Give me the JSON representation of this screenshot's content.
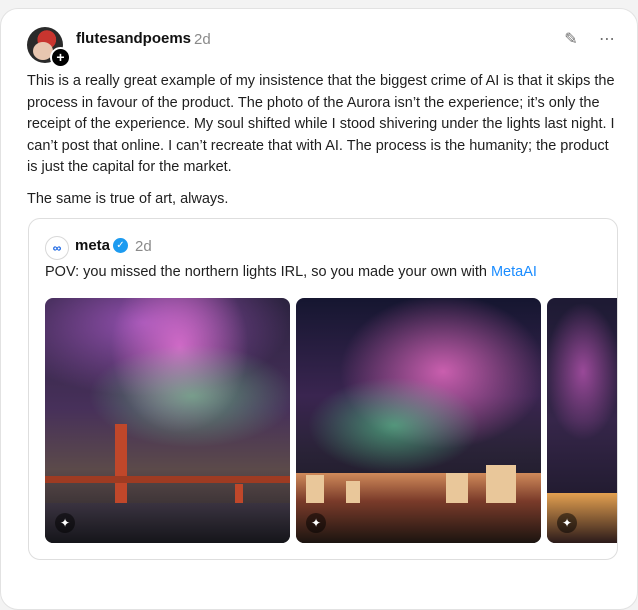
{
  "post": {
    "username": "flutesandpoems",
    "time": "2d",
    "paragraphs": [
      "This is a really great example of my insistence that the biggest crime of AI is that it skips the process in favour of the product. The photo of the Aurora isn’t the experience; it’s only the receipt of the experience. My soul shifted while I stood shivering under the lights last night. I can’t post that online. I can’t recreate that with AI. The process is the humanity; the product is just the capital for the market.",
      "The same is true of art, always."
    ]
  },
  "quote": {
    "name": "meta",
    "time": "2d",
    "text": "POV: you missed the northern lights IRL, so you made your own with ",
    "link": "MetaAI"
  },
  "icons": {
    "follow": "+",
    "edit": "✎",
    "more": "⋯",
    "logo": "∞",
    "verified": "✓",
    "ai": "✦"
  },
  "colors": {
    "link": "#1a8cff",
    "verified": "#1d9bf0"
  }
}
